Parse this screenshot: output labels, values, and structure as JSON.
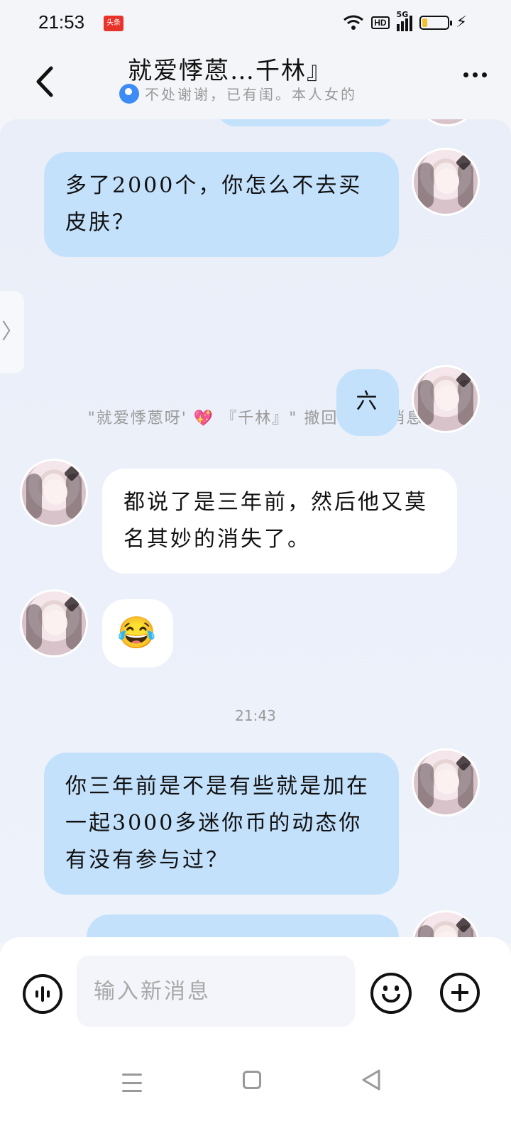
{
  "status_bar": {
    "time": "21:53",
    "app_badge": "头条",
    "network": "5G",
    "hd_label": "HD",
    "battery_level": 0.2
  },
  "header": {
    "back_icon": "chevron-left-icon",
    "title": "就爱悸蒽…千林』",
    "subtitle": "不处谢谢，已有闺。本人女的",
    "more_icon": "more-horizontal-icon"
  },
  "messages": [
    {
      "side": "right",
      "text": "多了2000个，你怎么不去买皮肤？"
    },
    {
      "type": "system",
      "text": "\"就爱悸蒽呀' 💖 『千林』\" 撤回了一条消息"
    },
    {
      "side": "right",
      "text": "六"
    },
    {
      "side": "left",
      "text": "都说了是三年前，然后他又莫名其妙的消失了。"
    },
    {
      "side": "left",
      "text": "😂",
      "kind": "emoji"
    },
    {
      "type": "time",
      "text": "21:43"
    },
    {
      "side": "right",
      "text": "你三年前是不是有些就是加在一起3000多迷你币的动态你有没有参与过？"
    }
  ],
  "composer": {
    "placeholder": "输入新消息",
    "voice_icon": "voice-icon",
    "emoji_icon": "smiley-icon",
    "plus_icon": "plus-icon"
  },
  "colors": {
    "bubble_self": "#c4e1fc",
    "bubble_other": "#ffffff",
    "chat_bg": "#e9eef8"
  }
}
